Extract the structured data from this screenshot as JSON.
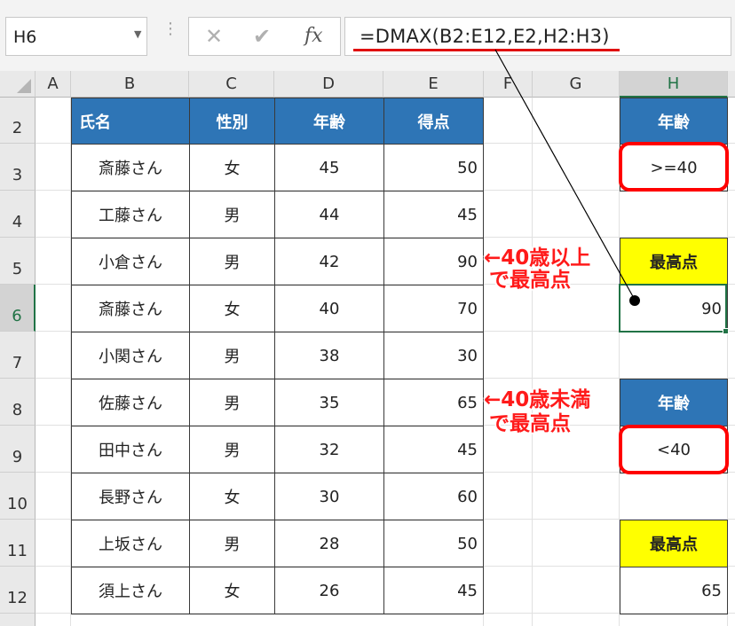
{
  "formula_bar": {
    "name_box": "H6",
    "formula": "=DMAX(B2:E12,E2,H2:H3)",
    "fx_label": "fx",
    "cancel_glyph": "✕",
    "enter_glyph": "✔"
  },
  "columns": [
    "A",
    "B",
    "C",
    "D",
    "E",
    "F",
    "G",
    "H"
  ],
  "rows": [
    "2",
    "3",
    "4",
    "5",
    "6",
    "7",
    "8",
    "9",
    "10",
    "11",
    "12",
    "13"
  ],
  "table": {
    "headers": [
      "氏名",
      "性別",
      "年齢",
      "得点"
    ],
    "records": [
      [
        "斎藤さん",
        "女",
        "45",
        "50"
      ],
      [
        "工藤さん",
        "男",
        "44",
        "45"
      ],
      [
        "小倉さん",
        "男",
        "42",
        "90"
      ],
      [
        "斎藤さん",
        "女",
        "40",
        "70"
      ],
      [
        "小関さん",
        "男",
        "38",
        "30"
      ],
      [
        "佐藤さん",
        "男",
        "35",
        "65"
      ],
      [
        "田中さん",
        "男",
        "32",
        "45"
      ],
      [
        "長野さん",
        "女",
        "30",
        "60"
      ],
      [
        "上坂さん",
        "男",
        "28",
        "50"
      ],
      [
        "須上さん",
        "女",
        "26",
        "45"
      ]
    ]
  },
  "criteria": {
    "h2": "年齢",
    "h3": ">=40",
    "h5": "最高点",
    "h6": "90",
    "h8": "年齢",
    "h9": "<40",
    "h11": "最高点",
    "h12": "65"
  },
  "annotations": {
    "first_line1": "←40歳以上",
    "first_line2": "で最高点",
    "second_line1": "←40歳未満",
    "second_line2": "で最高点"
  },
  "colors": {
    "header_blue": "#2e75b6",
    "header_yellow": "#ffff00",
    "highlight_red": "#ff0000",
    "selection_green": "#217346"
  }
}
